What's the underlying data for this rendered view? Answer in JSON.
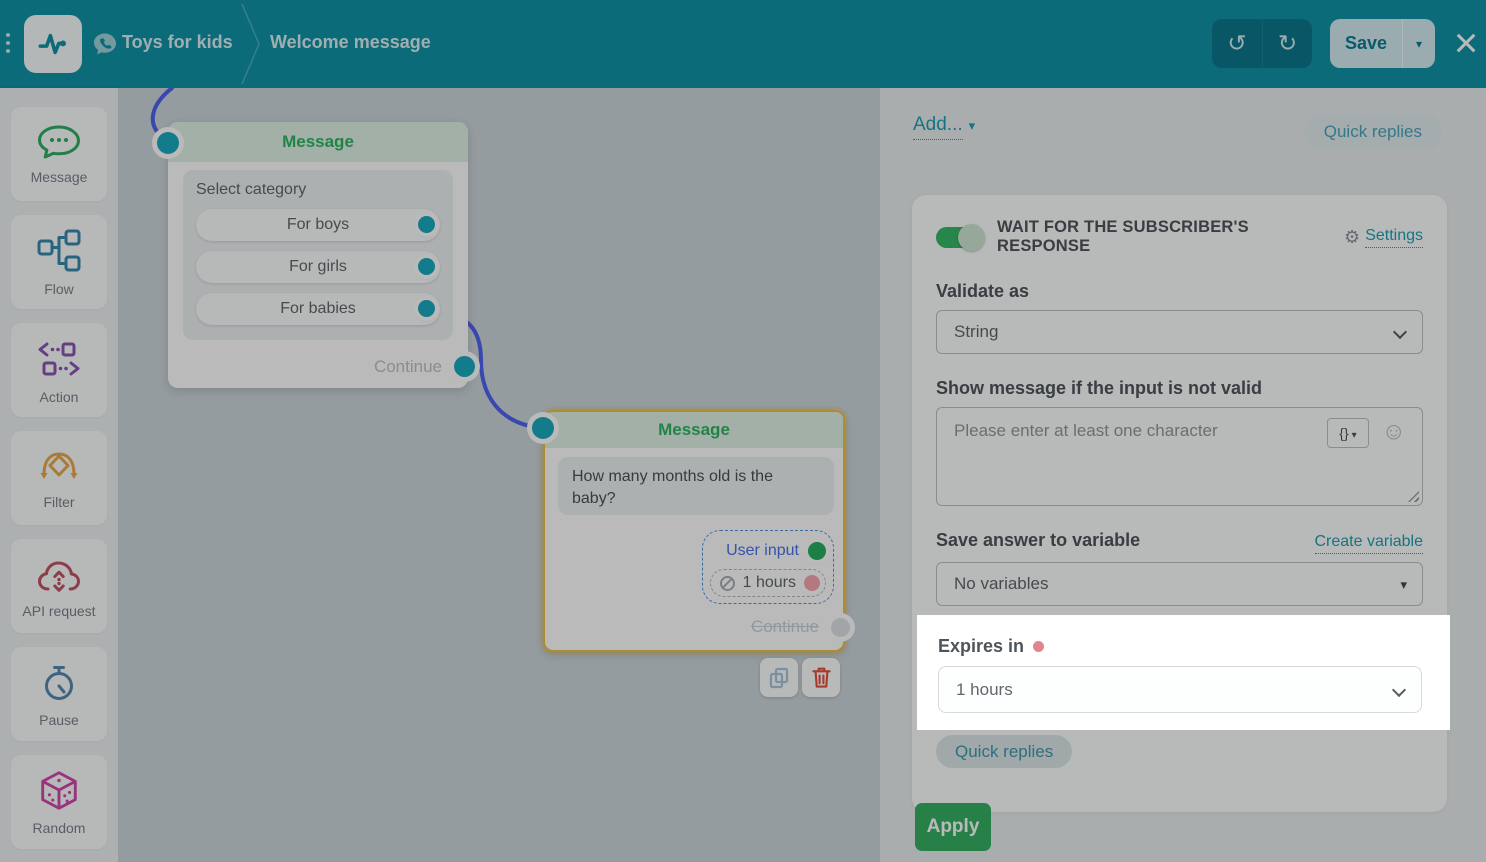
{
  "topbar": {
    "bot_name": "Toys for kids",
    "flow_name": "Welcome message",
    "save_label": "Save"
  },
  "sidebar": {
    "items": [
      {
        "label": "Message",
        "icon": "speech-bubble",
        "color": "#2fae63"
      },
      {
        "label": "Flow",
        "icon": "flow-nodes",
        "color": "#3a88b0"
      },
      {
        "label": "Action",
        "icon": "code-blocks",
        "color": "#8d55b4"
      },
      {
        "label": "Filter",
        "icon": "split-diamond",
        "color": "#eaa94c"
      },
      {
        "label": "API request",
        "icon": "cloud-sync",
        "color": "#c25465"
      },
      {
        "label": "Pause",
        "icon": "stopwatch",
        "color": "#5689b0"
      },
      {
        "label": "Random",
        "icon": "dice",
        "color": "#cf48ab"
      }
    ]
  },
  "canvas": {
    "node1": {
      "title": "Message",
      "prompt": "Select category",
      "buttons": [
        "For boys",
        "For girls",
        "For babies"
      ],
      "continue_label": "Continue"
    },
    "node2": {
      "title": "Message",
      "text": "How many months old is the baby?",
      "user_input_label": "User input",
      "timeout_label": "1 hours",
      "continue_label": "Continue",
      "selected": true
    }
  },
  "panel": {
    "add_label": "Add...",
    "quick_replies_top": "Quick replies",
    "wait_toggle": {
      "label": "WAIT FOR THE SUBSCRIBER'S RESPONSE",
      "on": true
    },
    "settings_label": "Settings",
    "validate_as": {
      "label": "Validate as",
      "value": "String"
    },
    "invalid_message": {
      "label": "Show message if the input is not valid",
      "value": "Please enter at least one character",
      "var_button": "{}"
    },
    "save_answer": {
      "label": "Save answer to variable",
      "link": "Create variable",
      "value": "No variables"
    },
    "expires": {
      "label": "Expires in",
      "value": "1 hours",
      "highlighted": true
    },
    "quick_replies_bottom": "Quick replies",
    "apply_label": "Apply"
  },
  "colors": {
    "topbar_teal": "#1193a7",
    "link_teal": "#1f9fb5",
    "node_header_green": "#2eb562",
    "selected_node_gold": "#f0bf45",
    "wire_blue": "#4f63f0",
    "port_teal": "#19abbf",
    "port_green": "#27ae60",
    "port_pink": "#f5a6ad",
    "apply_green": "#37b065",
    "toggle_green": "#36b866",
    "required_dot_red": "#e2848c"
  }
}
